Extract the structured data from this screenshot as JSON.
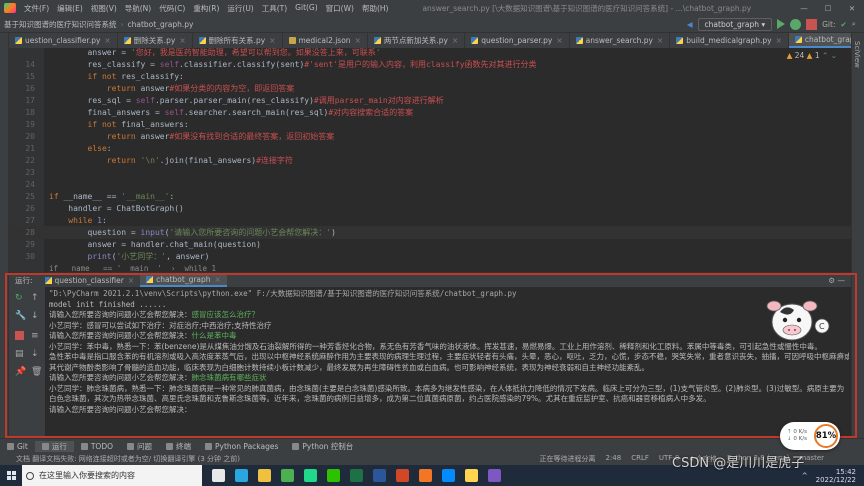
{
  "menubar": {
    "items": [
      "文件(F)",
      "编辑(E)",
      "视图(V)",
      "导航(N)",
      "代码(C)",
      "重构(R)",
      "运行(U)",
      "工具(T)",
      "Git(G)",
      "窗口(W)",
      "帮助(H)"
    ],
    "window_title": "answer_search.py [\\大数据知识图谱\\基于知识图谱的医疗知识问答系统] - ...\\chatbot_graph.py"
  },
  "breadcrumb": {
    "project": "基于知识图谱的医疗知识问答系统",
    "file": "chatbot_graph.py"
  },
  "toolbar": {
    "run_config": "chatbot_graph"
  },
  "tabs": [
    {
      "label": "uestion_classifier.py",
      "icon": "python-file-icon"
    },
    {
      "label": "删除关系.py",
      "icon": "python-file-icon"
    },
    {
      "label": "删除所有关系.py",
      "icon": "python-file-icon"
    },
    {
      "label": "medical2.json",
      "icon": "json-file-icon"
    },
    {
      "label": "两节点新加关系.py",
      "icon": "python-file-icon"
    },
    {
      "label": "question_parser.py",
      "icon": "python-file-icon"
    },
    {
      "label": "answer_search.py",
      "icon": "python-file-icon"
    },
    {
      "label": "build_medicalgraph.py",
      "icon": "python-file-icon"
    },
    {
      "label": "chatbot_graph.py",
      "icon": "python-file-icon",
      "active": true
    },
    {
      "label": "medical.json",
      "icon": "json-file-icon"
    }
  ],
  "editor": {
    "inspections": {
      "warnings": "24",
      "weak": "1"
    },
    "lines": [
      {
        "n": "",
        "parts": [
          [
            "pl",
            "        answer = "
          ],
          [
            "st",
            "'"
          ],
          [
            "cm",
            "您好，我是医药智能助理，希望可以帮到您。如果没答上来，可联系"
          ],
          [
            "st",
            "'"
          ]
        ]
      },
      {
        "n": "14",
        "parts": [
          [
            "pl",
            "        res_classify = "
          ],
          [
            "self",
            "self"
          ],
          [
            "pl",
            ".classifier.classify(sent)"
          ],
          [
            "cm",
            "#'sent'是用户的输入内容，利用classify函数先对其进行分类"
          ]
        ]
      },
      {
        "n": "15",
        "parts": [
          [
            "pl",
            "        "
          ],
          [
            "kw",
            "if not "
          ],
          [
            "pl",
            "res_classify:"
          ]
        ]
      },
      {
        "n": "16",
        "parts": [
          [
            "pl",
            "            "
          ],
          [
            "kw",
            "return "
          ],
          [
            "pl",
            "answer"
          ],
          [
            "cm",
            "#如果分类的内容为空，即返回答案"
          ]
        ]
      },
      {
        "n": "17",
        "parts": [
          [
            "pl",
            "        res_sql = "
          ],
          [
            "self",
            "self"
          ],
          [
            "pl",
            ".parser.parser_main(res_classify)"
          ],
          [
            "cm",
            "#调用parser_main对内容进行解析"
          ]
        ]
      },
      {
        "n": "18",
        "parts": [
          [
            "pl",
            "        final_answers = "
          ],
          [
            "self",
            "self"
          ],
          [
            "pl",
            ".searcher.search_main(res_sql)"
          ],
          [
            "cm",
            "#对内容搜索合适的答案"
          ]
        ]
      },
      {
        "n": "19",
        "parts": [
          [
            "pl",
            "        "
          ],
          [
            "kw",
            "if not "
          ],
          [
            "pl",
            "final_answers:"
          ]
        ]
      },
      {
        "n": "20",
        "parts": [
          [
            "pl",
            "            "
          ],
          [
            "kw",
            "return "
          ],
          [
            "pl",
            "answer"
          ],
          [
            "cm",
            "#如果没有找到合适的最终答案，返回初始答案"
          ]
        ]
      },
      {
        "n": "21",
        "parts": [
          [
            "pl",
            "        "
          ],
          [
            "kw",
            "else"
          ],
          [
            "pl",
            ":"
          ]
        ]
      },
      {
        "n": "22",
        "parts": [
          [
            "pl",
            "            "
          ],
          [
            "kw",
            "return "
          ],
          [
            "st",
            "'\\n'"
          ],
          [
            "pl",
            ".join(final_answers)"
          ],
          [
            "cm",
            "#连接字符"
          ]
        ]
      },
      {
        "n": "23",
        "parts": []
      },
      {
        "n": "24",
        "parts": []
      },
      {
        "n": "25",
        "parts": [
          [
            "kw",
            "if "
          ],
          [
            "pl",
            "__name__ == "
          ],
          [
            "st",
            "'__main__'"
          ],
          [
            "pl",
            ":"
          ]
        ]
      },
      {
        "n": "26",
        "parts": [
          [
            "pl",
            "    handler = ChatBotGraph()"
          ]
        ]
      },
      {
        "n": "27",
        "parts": [
          [
            "pl",
            "    "
          ],
          [
            "kw",
            "while "
          ],
          [
            "bi",
            "1"
          ],
          [
            "pl",
            ":"
          ]
        ]
      },
      {
        "n": "28",
        "parts": [
          [
            "pl",
            "        question = "
          ],
          [
            "bi",
            "input"
          ],
          [
            "pl",
            "("
          ],
          [
            "st",
            "'请输入您所要咨询的问题小艺会帮您解决：'"
          ],
          [
            "pl",
            ")"
          ]
        ],
        "highlight": true
      },
      {
        "n": "29",
        "parts": [
          [
            "pl",
            "        answer = handler.chat_main(question)"
          ]
        ]
      },
      {
        "n": "30",
        "parts": [
          [
            "pl",
            "        "
          ],
          [
            "bi",
            "print"
          ],
          [
            "pl",
            "("
          ],
          [
            "st",
            "'小艺同学：'"
          ],
          [
            "pl",
            ", answer)"
          ]
        ]
      }
    ],
    "footer_breadcrumb": "if __name__ == '__main__'  ›  while 1"
  },
  "run_panel": {
    "label": "运行:",
    "tabs": [
      {
        "label": "question_classifier"
      },
      {
        "label": "chatbot_graph",
        "active": true
      }
    ],
    "output": [
      {
        "cls": "dim mono",
        "text": "\"D:\\PyCharm 2021.2.1\\venv\\Scripts\\python.exe\" F:/大数据知识图谱/基于知识图谱的医疗知识问答系统/chatbot_graph.py"
      },
      {
        "cls": "mono",
        "text": "model init finished ......"
      },
      {
        "cls": "",
        "parts": [
          [
            "",
            "请输入您所要咨询的问题小艺会帮您解决："
          ],
          [
            "user",
            "感冒应该怎么治疗？"
          ]
        ]
      },
      {
        "cls": "",
        "text": "小艺同学：感冒可以尝试如下治疗：对症治疗;中西治疗;支持性治疗"
      },
      {
        "cls": "",
        "parts": [
          [
            "",
            "请输入您所要咨询的问题小艺会帮您解决："
          ],
          [
            "user",
            "什么是苯中毒"
          ]
        ]
      },
      {
        "cls": "",
        "text": "小艺同学：苯中毒，熟悉一下：苯(benzene)是从煤焦油分馏及石油裂解所得的一种芳香烃化合物，系无色有芳香气味的油状液体。挥发甚速，易燃易爆。工业上用作溶剂、稀释剂和化工原料。苯属中等毒类，可引起急性或慢性中毒。"
      },
      {
        "cls": "",
        "text": "急性苯中毒是指口服含苯的有机溶剂或吸入高浓度苯蒸气后，出现以中枢神经系统麻醉作用为主要表现的病理生理过程，主要症状轻者有头痛，头晕，恶心，呕吐，乏力，心慌，步态不稳，哭笑失常，重者意识丧失，抽搐，可因呼吸中枢麻痹或循环衰竭而死亡。慢性苯中毒是指苯及"
      },
      {
        "cls": "",
        "text": "其代谢产物酚类影响了骨髓的造血功能，临床表现为白细胞计数持续小板计数减少，最终发展为再生障碍性贫血或白血病。也可影响神经系统，表现为神经衰弱和自主神经功能紊乱。"
      },
      {
        "cls": "",
        "parts": [
          [
            "",
            "请输入您所要咨询的问题小艺会帮您解决："
          ],
          [
            "user",
            "肺念珠菌病有哪些症状"
          ]
        ]
      },
      {
        "cls": "",
        "text": "小艺同学：肺念珠菌病，熟悉一下：肺念珠菌病是一种常见的肺真菌病，由念珠菌(主要是白念珠菌)感染所致。本病多为继发性感染，在人体抵抗力降低的情况下发病。临床上可分为三型，(1)支气管炎型。(2)肺炎型。(3)过敏型。病原主要为"
      },
      {
        "cls": "",
        "text": "白色念珠菌，其次为热带念珠菌、高里氏念珠菌和克鲁斯念珠菌等。近年来，念珠菌的病例日益增多，成为第二位真菌病原菌，约占医院感染的79%。尤其在重症监护室、抗癌和器官移植病人中多发。"
      },
      {
        "cls": "",
        "text": "请输入您所要咨询的问题小艺会帮您解决："
      }
    ]
  },
  "bottom_tools": [
    {
      "label": "Git",
      "icon": "git-icon"
    },
    {
      "label": "运行",
      "icon": "run-icon",
      "active": true
    },
    {
      "label": "TODO",
      "icon": "todo-icon"
    },
    {
      "label": "问题",
      "icon": "problems-icon"
    },
    {
      "label": "终端",
      "icon": "terminal-icon"
    },
    {
      "label": "Python Packages",
      "icon": "packages-icon"
    },
    {
      "label": "Python 控制台",
      "icon": "console-icon"
    }
  ],
  "statusbar": {
    "left": "文档 翻译文档失败: 网络连接超时或者为空/ 切换翻译引擎 (3 分钟 之前)",
    "right": [
      "正在等待进程分离",
      "2:48",
      "CRLF",
      "UTF-8",
      "4 个空格",
      "Python 3.8 (venv)",
      "master"
    ]
  },
  "taskbar": {
    "search_placeholder": "在这里输入你要搜索的内容",
    "apps": [
      {
        "name": "task-view",
        "color": "#e8e8e8"
      },
      {
        "name": "edge",
        "color": "#2aa7e0"
      },
      {
        "name": "file-explorer",
        "color": "#f0c040"
      },
      {
        "name": "chrome",
        "color": "#4caf50"
      },
      {
        "name": "pycharm",
        "color": "#21d789"
      },
      {
        "name": "wechat",
        "color": "#2dc100"
      },
      {
        "name": "excel",
        "color": "#1e7145"
      },
      {
        "name": "word",
        "color": "#2b579a"
      },
      {
        "name": "powerpoint",
        "color": "#d24726"
      },
      {
        "name": "jupyter",
        "color": "#f37626"
      },
      {
        "name": "neo4j",
        "color": "#018bff"
      },
      {
        "name": "notes",
        "color": "#ffd54f"
      },
      {
        "name": "photos",
        "color": "#7e57c2"
      }
    ],
    "time": "15:42",
    "date": "2022/12/22"
  },
  "perf_widget": {
    "up": "0 K/s",
    "down": "0 K/s",
    "percent": "81%"
  },
  "watermark": "CSDN @是川川是虎子"
}
